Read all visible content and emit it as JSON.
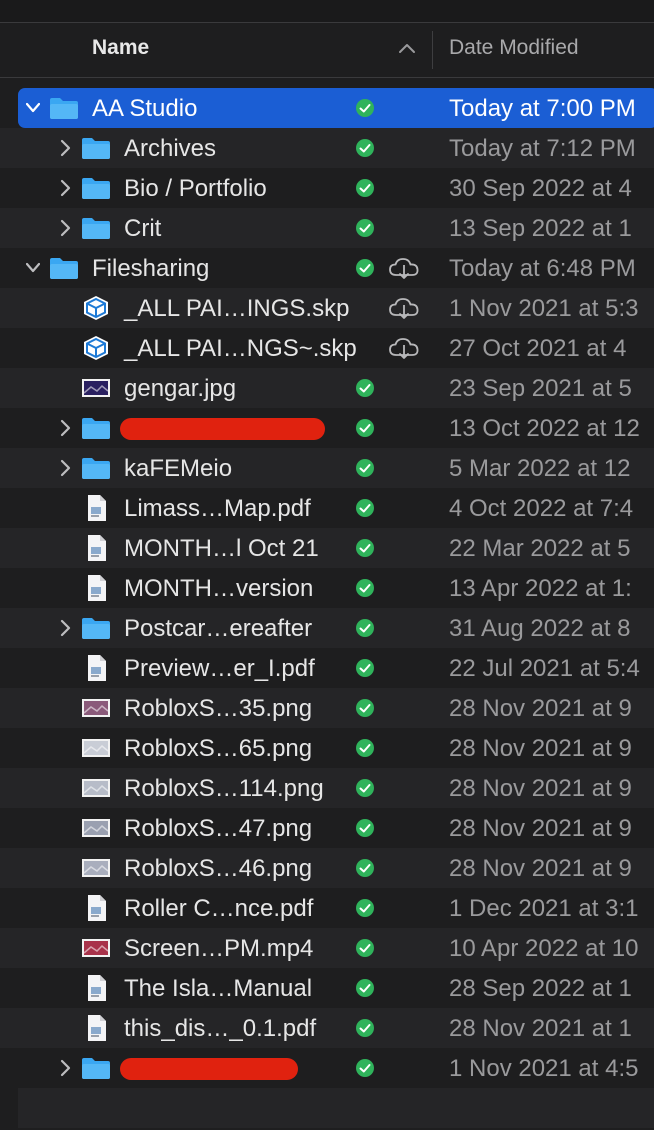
{
  "header": {
    "name_label": "Name",
    "date_label": "Date Modified"
  },
  "colors": {
    "selection": "#1b5ed4",
    "folder": "#3aa7f2",
    "sync_check": "#2fb35b",
    "redaction": "#e0220f"
  },
  "rows": [
    {
      "name": "AA Studio",
      "date": "Today at 7:00 PM",
      "type": "folder",
      "icon": "folder-icon",
      "indent": 0,
      "expanded": true,
      "selected": true,
      "synced": true,
      "cloud": false
    },
    {
      "name": "Archives",
      "date": "Today at 7:12 PM",
      "type": "folder",
      "icon": "folder-icon",
      "indent": 1,
      "expanded": false,
      "synced": true,
      "cloud": false
    },
    {
      "name": "Bio / Portfolio",
      "date": "30 Sep 2022 at 4",
      "type": "folder",
      "icon": "folder-icon",
      "indent": 1,
      "expanded": false,
      "synced": true,
      "cloud": false
    },
    {
      "name": "Crit",
      "date": "13 Sep 2022 at 1",
      "type": "folder",
      "icon": "folder-icon",
      "indent": 1,
      "expanded": false,
      "synced": true,
      "cloud": false
    },
    {
      "name": "Filesharing",
      "date": "Today at 6:48 PM",
      "type": "folder",
      "icon": "folder-icon",
      "indent": 0,
      "expanded": true,
      "synced": true,
      "cloud": true
    },
    {
      "name": "_ALL PAI…INGS.skp",
      "date": "1 Nov 2021 at 5:3",
      "type": "skp",
      "icon": "sketchup-icon",
      "indent": 1,
      "synced": false,
      "cloud": true
    },
    {
      "name": "_ALL PAI…NGS~.skp",
      "date": "27 Oct 2021 at 4",
      "type": "skp",
      "icon": "sketchup-icon",
      "indent": 1,
      "synced": false,
      "cloud": true
    },
    {
      "name": "gengar.jpg",
      "date": "23 Sep 2021 at 5",
      "type": "image",
      "icon": "image-thumbnail-icon",
      "thumb": "#2a2060",
      "indent": 1,
      "synced": true,
      "cloud": false
    },
    {
      "name": "",
      "date": "13 Oct 2022 at 12",
      "type": "folder",
      "icon": "folder-icon",
      "indent": 1,
      "expanded": false,
      "synced": true,
      "cloud": false,
      "redacted": true
    },
    {
      "name": "kaFEMeio",
      "date": "5 Mar 2022 at 12",
      "type": "folder",
      "icon": "folder-icon",
      "indent": 1,
      "expanded": false,
      "synced": true,
      "cloud": false
    },
    {
      "name": "Limass…Map.pdf",
      "date": "4 Oct 2022 at 7:4",
      "type": "doc",
      "icon": "document-icon",
      "indent": 1,
      "synced": true,
      "cloud": false
    },
    {
      "name": "MONTH…l Oct 21",
      "date": "22 Mar 2022 at 5",
      "type": "doc",
      "icon": "document-icon",
      "indent": 1,
      "synced": true,
      "cloud": false
    },
    {
      "name": "MONTH…version",
      "date": "13 Apr 2022 at 1:",
      "type": "doc",
      "icon": "document-icon",
      "indent": 1,
      "synced": true,
      "cloud": false
    },
    {
      "name": "Postcar…ereafter",
      "date": "31 Aug 2022 at 8",
      "type": "folder",
      "icon": "folder-icon",
      "indent": 1,
      "expanded": false,
      "synced": true,
      "cloud": false
    },
    {
      "name": "Preview…er_I.pdf",
      "date": "22 Jul 2021 at 5:4",
      "type": "doc",
      "icon": "document-icon",
      "indent": 1,
      "synced": true,
      "cloud": false
    },
    {
      "name": "RobloxS…35.png",
      "date": "28 Nov 2021 at 9",
      "type": "image",
      "icon": "image-thumbnail-icon",
      "thumb": "#8a5a7a",
      "indent": 1,
      "synced": true,
      "cloud": false
    },
    {
      "name": "RobloxS…65.png",
      "date": "28 Nov 2021 at 9",
      "type": "image",
      "icon": "image-thumbnail-icon",
      "thumb": "#c9cdd6",
      "indent": 1,
      "synced": true,
      "cloud": false
    },
    {
      "name": "RobloxS…114.png",
      "date": "28 Nov 2021 at 9",
      "type": "image",
      "icon": "image-thumbnail-icon",
      "thumb": "#b7bcc8",
      "indent": 1,
      "synced": true,
      "cloud": false
    },
    {
      "name": "RobloxS…47.png",
      "date": "28 Nov 2021 at 9",
      "type": "image",
      "icon": "image-thumbnail-icon",
      "thumb": "#9aa0b0",
      "indent": 1,
      "synced": true,
      "cloud": false
    },
    {
      "name": "RobloxS…46.png",
      "date": "28 Nov 2021 at 9",
      "type": "image",
      "icon": "image-thumbnail-icon",
      "thumb": "#a9aebd",
      "indent": 1,
      "synced": true,
      "cloud": false
    },
    {
      "name": "Roller C…nce.pdf",
      "date": "1 Dec 2021 at 3:1",
      "type": "doc",
      "icon": "document-icon",
      "indent": 1,
      "synced": true,
      "cloud": false
    },
    {
      "name": "Screen…PM.mp4",
      "date": "10 Apr 2022 at 10",
      "type": "video",
      "icon": "video-thumbnail-icon",
      "thumb": "#a8324a",
      "indent": 1,
      "synced": true,
      "cloud": false
    },
    {
      "name": "The Isla…Manual",
      "date": "28 Sep 2022 at 1",
      "type": "doc",
      "icon": "document-icon",
      "indent": 1,
      "synced": true,
      "cloud": false
    },
    {
      "name": "this_dis…_0.1.pdf",
      "date": "28 Nov 2021 at 1",
      "type": "doc",
      "icon": "document-icon",
      "indent": 1,
      "synced": true,
      "cloud": false
    },
    {
      "name": "",
      "date": "1 Nov 2021 at 4:5",
      "type": "folder",
      "icon": "folder-icon",
      "indent": 1,
      "expanded": false,
      "synced": true,
      "cloud": false,
      "redacted": true
    }
  ]
}
